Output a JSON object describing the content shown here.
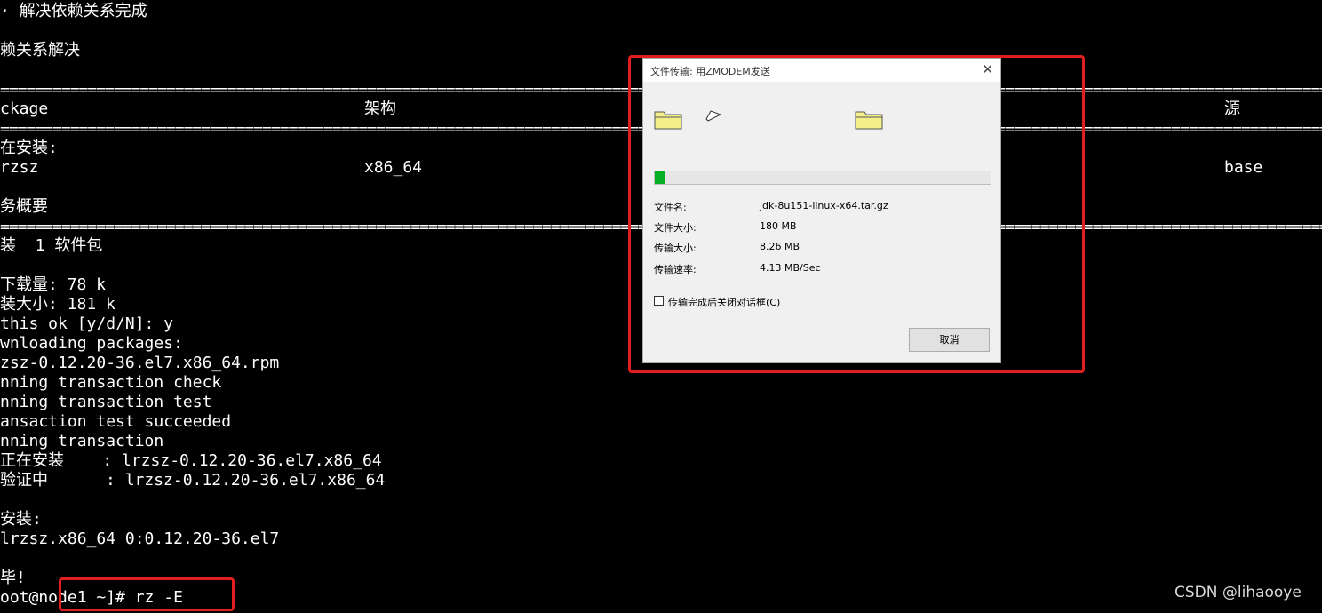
{
  "terminal": {
    "lines": [
      "· 解决依赖关系完成",
      "赖关系解决",
      "ckage",
      "在安装:",
      "rzsz",
      "务概要",
      "装  1 软件包",
      "下载量: 78 k",
      "装大小: 181 k",
      "this ok [y/d/N]: y",
      "wnloading packages:",
      "zsz-0.12.20-36.el7.x86_64.rpm",
      "nning transaction check",
      "nning transaction test",
      "ansaction test succeeded",
      "nning transaction",
      "正在安装    : lrzsz-0.12.20-36.el7.x86_64",
      "验证中      : lrzsz-0.12.20-36.el7.x86_64",
      "安装:",
      "lrzsz.x86_64 0:0.12.20-36.el7",
      "毕!",
      "oot@node1 ~]# rz -E"
    ],
    "col_arch_header": "架构",
    "col_source_header": "源",
    "arch_value": "x86_64",
    "source_value": "base",
    "separator": "=================================================================================================================================================================================="
  },
  "dialog": {
    "title": "文件传输: 用ZMODEM发送",
    "close_glyph": "✕",
    "progress": 0.03,
    "labels": {
      "filename": "文件名:",
      "filesize": "文件大小:",
      "transferred": "传输大小:",
      "speed": "传输速率:"
    },
    "values": {
      "filename": "jdk-8u151-linux-x64.tar.gz",
      "filesize": "180 MB",
      "transferred": "8.26 MB",
      "speed": "4.13 MB/Sec"
    },
    "close_after_label": "传输完成后关闭对话框(C)",
    "cancel_label": "取消"
  },
  "watermark": "CSDN @lihaooye",
  "colors": {
    "highlight": "#e01e1e",
    "progress": "#06b025",
    "folder": "#f3f08a"
  }
}
